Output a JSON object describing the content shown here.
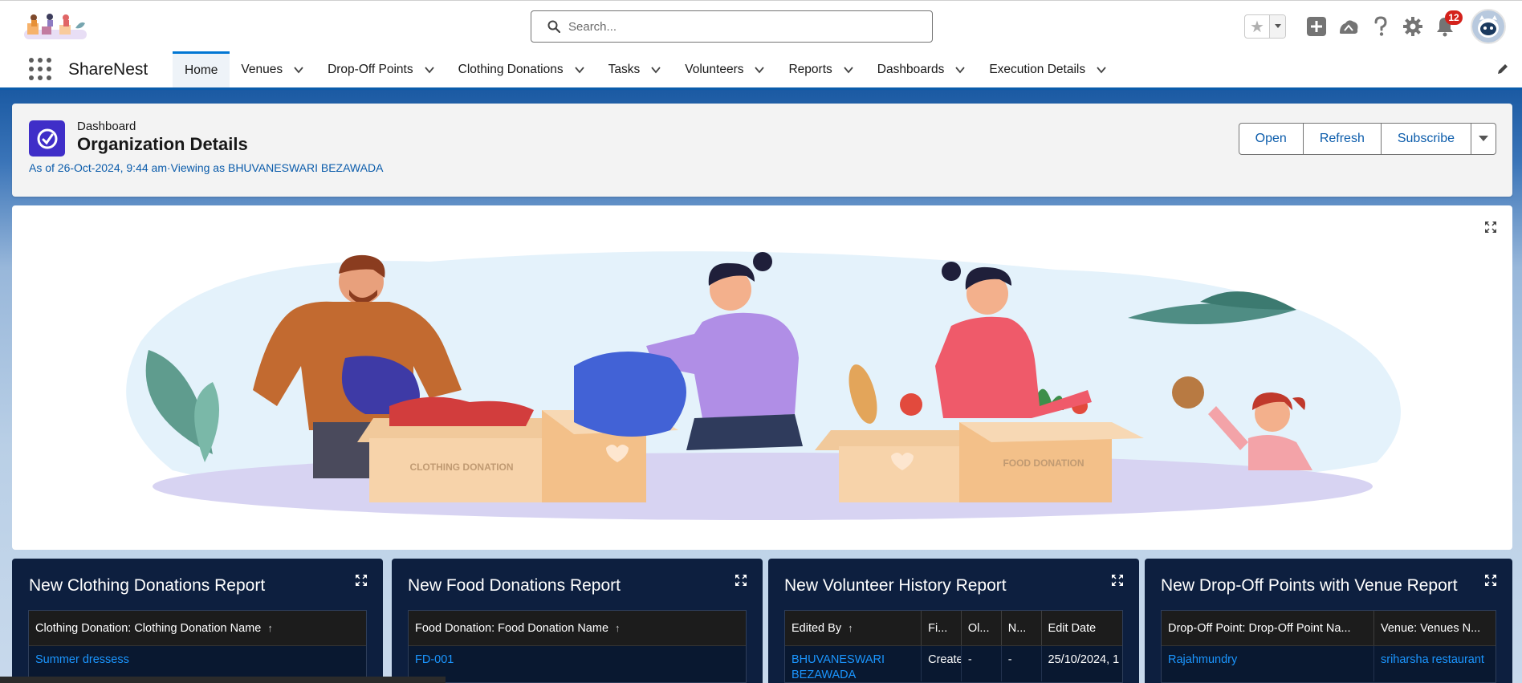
{
  "header": {
    "search_placeholder": "Search...",
    "notification_count": "12",
    "icons": [
      "star-icon",
      "chevron-down-icon",
      "add-icon",
      "trailhead-icon",
      "help-icon",
      "gear-icon",
      "bell-icon",
      "avatar"
    ]
  },
  "nav": {
    "app_name": "ShareNest",
    "tabs": [
      {
        "label": "Home",
        "has_menu": false
      },
      {
        "label": "Venues",
        "has_menu": true
      },
      {
        "label": "Drop-Off Points",
        "has_menu": true
      },
      {
        "label": "Clothing Donations",
        "has_menu": true
      },
      {
        "label": "Tasks",
        "has_menu": true
      },
      {
        "label": "Volunteers",
        "has_menu": true
      },
      {
        "label": "Reports",
        "has_menu": true
      },
      {
        "label": "Dashboards",
        "has_menu": true
      },
      {
        "label": "Execution Details",
        "has_menu": true
      }
    ]
  },
  "dashboard": {
    "type_label": "Dashboard",
    "title": "Organization Details",
    "meta": "As of 26-Oct-2024, 9:44 am·Viewing as BHUVANESWARI BEZAWADA",
    "buttons": {
      "open": "Open",
      "refresh": "Refresh",
      "subscribe": "Subscribe"
    }
  },
  "illustration": {
    "box_left_label": "CLOTHING DONATION",
    "box_right_label": "FOOD DONATION"
  },
  "reports": [
    {
      "title": "New Clothing Donations Report",
      "columns": [
        "Clothing Donation: Clothing Donation Name"
      ],
      "rows": [
        [
          "Summer dressess"
        ]
      ]
    },
    {
      "title": "New Food Donations Report",
      "columns": [
        "Food Donation: Food Donation Name"
      ],
      "rows": [
        [
          "FD-001"
        ]
      ]
    },
    {
      "title": "New Volunteer History Report",
      "columns": [
        "Edited By",
        "Fi...",
        "Ol...",
        "N...",
        "Edit Date"
      ],
      "rows": [
        [
          "BHUVANESWARI BEZAWADA",
          "Created.",
          "-",
          "-",
          "25/10/2024, 1"
        ]
      ]
    },
    {
      "title": "New Drop-Off Points with Venue Report",
      "columns": [
        "Drop-Off Point: Drop-Off Point Na...",
        "Venue: Venues N..."
      ],
      "rows": [
        [
          "Rajahmundry",
          "sriharsha restaurant"
        ]
      ]
    }
  ],
  "colors": {
    "brand_blue": "#0b5cab",
    "link_blue": "#1b96ff",
    "card_navy": "#0d1f3f",
    "dashboard_icon": "#3f2ec8",
    "badge_red": "#d4211b"
  }
}
